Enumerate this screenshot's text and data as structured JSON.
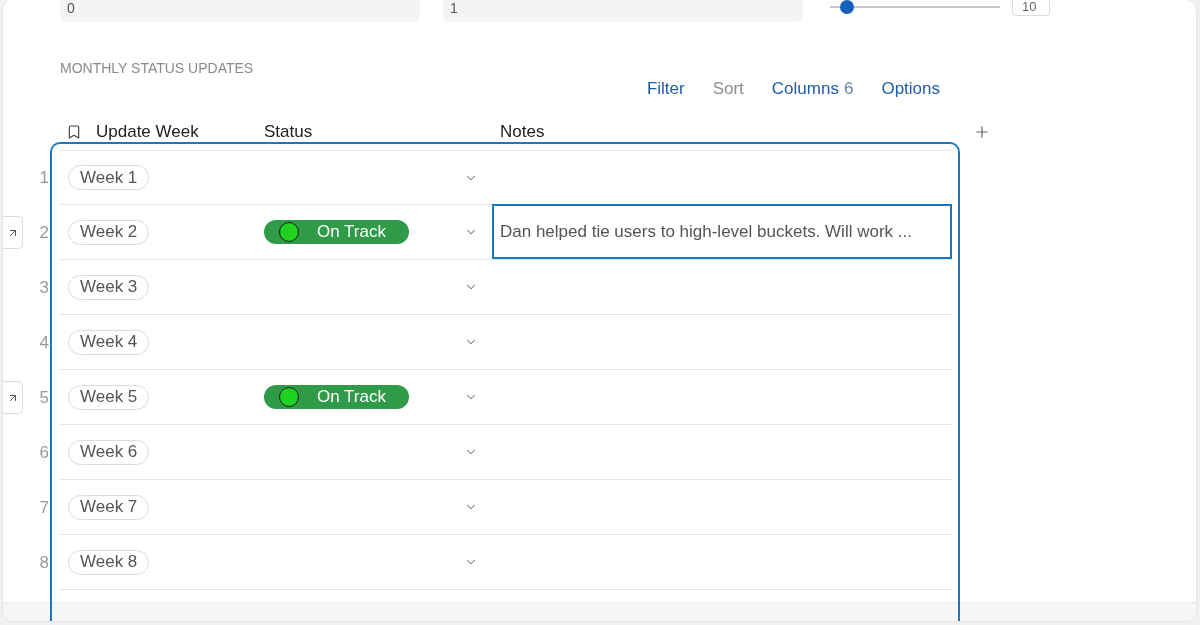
{
  "top_controls": {
    "fields": [
      {
        "value": "0"
      },
      {
        "value": "1"
      }
    ],
    "slider": {
      "level": 0.1
    },
    "number_field": {
      "value": "10"
    }
  },
  "section": {
    "title": "MONTHLY STATUS UPDATES"
  },
  "toolbar": [
    {
      "label": "Filter",
      "disabled": false
    },
    {
      "label": "Sort",
      "disabled": true
    },
    {
      "label": "Columns",
      "count": "6",
      "disabled": false
    },
    {
      "label": "Options",
      "disabled": false
    }
  ],
  "table": {
    "columns": [
      {
        "label": "Update Week"
      },
      {
        "label": "Status"
      },
      {
        "label": "Notes"
      }
    ],
    "rows": [
      {
        "number": "1",
        "week": "Week 1",
        "open_button": false,
        "notes": {
          "selected": false
        }
      },
      {
        "number": "2",
        "week": "Week 2",
        "open_button": true,
        "status": {
          "label": "On Track",
          "color": "#1fd21f"
        },
        "notes": {
          "text": "Dan helped tie users to high-level buckets. Will work ...",
          "selected": true
        }
      },
      {
        "number": "3",
        "week": "Week 3",
        "open_button": false,
        "notes": {
          "selected": false
        }
      },
      {
        "number": "4",
        "week": "Week 4",
        "open_button": false,
        "notes": {
          "selected": false
        }
      },
      {
        "number": "5",
        "week": "Week 5",
        "open_button": true,
        "status": {
          "label": "On Track",
          "color": "#1fd21f"
        },
        "notes": {
          "selected": false
        }
      },
      {
        "number": "6",
        "week": "Week 6",
        "open_button": false,
        "notes": {
          "selected": false
        }
      },
      {
        "number": "7",
        "week": "Week 7",
        "open_button": false,
        "notes": {
          "selected": false
        }
      },
      {
        "number": "8",
        "week": "Week 8",
        "open_button": false,
        "notes": {
          "selected": false
        }
      }
    ]
  }
}
